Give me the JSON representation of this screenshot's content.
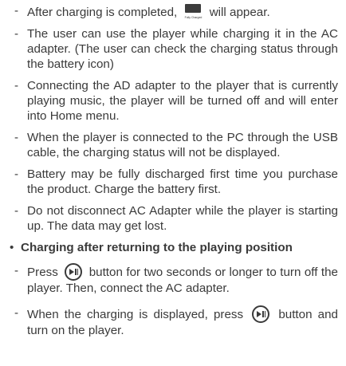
{
  "notes": [
    {
      "before": "After charging is completed, ",
      "icon": "fully-charged-screen-icon",
      "icon_caption": "Fully Charged",
      "after": " will appear."
    },
    {
      "text": "The user can use the player while charging it in the AC adapter. (The user can check the charging status through the battery icon)"
    },
    {
      "text": "Connecting the AD adapter to the player that is currently playing music, the player will be turned off and will enter into Home menu."
    },
    {
      "text": "When the player is connected to the PC through the USB cable, the charging status will not be displayed."
    },
    {
      "text": "Battery may be fully discharged first time you purchase the product. Charge the battery first."
    },
    {
      "text": "Do not disconnect AC Adapter while the player is starting up. The data may get lost."
    }
  ],
  "section": {
    "title": "Charging after returning to the playing position",
    "steps": [
      {
        "before": "Press ",
        "icon": "play-pause-icon",
        "after": " button for two seconds or longer to turn off the player. Then, connect the AC adapter."
      },
      {
        "before": "When the charging is displayed, press ",
        "icon": "play-pause-icon",
        "after": " button and turn on the player."
      }
    ]
  },
  "glyphs": {
    "dash": "-",
    "bullet": "•"
  }
}
